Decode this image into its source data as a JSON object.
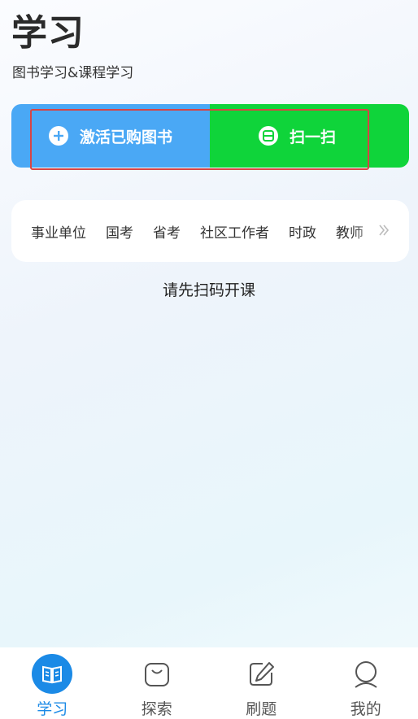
{
  "header": {
    "title": "学习",
    "subtitle": "图书学习&课程学习"
  },
  "actions": {
    "activate_label": "激活已购图书",
    "scan_label": "扫一扫"
  },
  "categories": [
    "事业单位",
    "国考",
    "省考",
    "社区工作者",
    "时政",
    "教师"
  ],
  "empty_hint": "请先扫码开课",
  "tabbar": {
    "tabs": [
      {
        "label": "学习",
        "icon": "book-icon",
        "active": true
      },
      {
        "label": "探索",
        "icon": "bag-icon",
        "active": false
      },
      {
        "label": "刷题",
        "icon": "pencil-icon",
        "active": false
      },
      {
        "label": "我的",
        "icon": "user-icon",
        "active": false
      }
    ]
  },
  "colors": {
    "activate_bg": "#4aa8f5",
    "scan_bg": "#0fd43a",
    "accent": "#1b8ae6",
    "highlight": "#d64545"
  }
}
